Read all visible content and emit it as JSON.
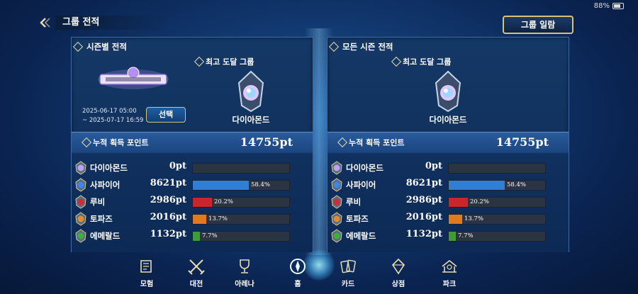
{
  "status": {
    "battery": "88%"
  },
  "header": {
    "title": "그룹 전적",
    "group_list_button": "그룹 일람"
  },
  "left_panel": {
    "title": "시즌별 전적",
    "best_group_label": "최고 도달 그룹",
    "best_group_name": "다이아몬드",
    "period_start": "2025-06-17 05:00",
    "period_end": "~ 2025-07-17 16:59",
    "select_button": "선택",
    "points_label": "누적 획득 포인트",
    "points_total": "14755pt",
    "tiers": [
      {
        "name": "다이아몬드",
        "points": "0pt",
        "percent": "",
        "fill": 0,
        "color": "#4a8fe0"
      },
      {
        "name": "사파이어",
        "points": "8621pt",
        "percent": "58.4%",
        "fill": 0.584,
        "color": "#2f7fd6"
      },
      {
        "name": "루비",
        "points": "2986pt",
        "percent": "20.2%",
        "fill": 0.202,
        "color": "#c8262c"
      },
      {
        "name": "토파즈",
        "points": "2016pt",
        "percent": "13.7%",
        "fill": 0.137,
        "color": "#e07a1e"
      },
      {
        "name": "에메랄드",
        "points": "1132pt",
        "percent": "7.7%",
        "fill": 0.077,
        "color": "#3f9b35"
      }
    ]
  },
  "right_panel": {
    "title": "모든 시즌 전적",
    "best_group_label": "최고 도달 그룹",
    "best_group_name": "다이아몬드",
    "points_label": "누적 획득 포인트",
    "points_total": "14755pt",
    "tiers": [
      {
        "name": "다이아몬드",
        "points": "0pt",
        "percent": "",
        "fill": 0,
        "color": "#4a8fe0"
      },
      {
        "name": "사파이어",
        "points": "8621pt",
        "percent": "58.4%",
        "fill": 0.584,
        "color": "#2f7fd6"
      },
      {
        "name": "루비",
        "points": "2986pt",
        "percent": "20.2%",
        "fill": 0.202,
        "color": "#c8262c"
      },
      {
        "name": "토파즈",
        "points": "2016pt",
        "percent": "13.7%",
        "fill": 0.137,
        "color": "#e07a1e"
      },
      {
        "name": "에메랄드",
        "points": "1132pt",
        "percent": "7.7%",
        "fill": 0.077,
        "color": "#3f9b35"
      }
    ]
  },
  "nav": {
    "items": [
      {
        "label": "모험",
        "icon": "adventure-icon"
      },
      {
        "label": "대전",
        "icon": "crossed-swords-icon"
      },
      {
        "label": "아레나",
        "icon": "trophy-icon"
      },
      {
        "label": "홈",
        "icon": "home-emblem-icon"
      },
      {
        "label": "카드",
        "icon": "cards-icon"
      },
      {
        "label": "상점",
        "icon": "shop-icon"
      },
      {
        "label": "파크",
        "icon": "park-icon"
      }
    ]
  }
}
